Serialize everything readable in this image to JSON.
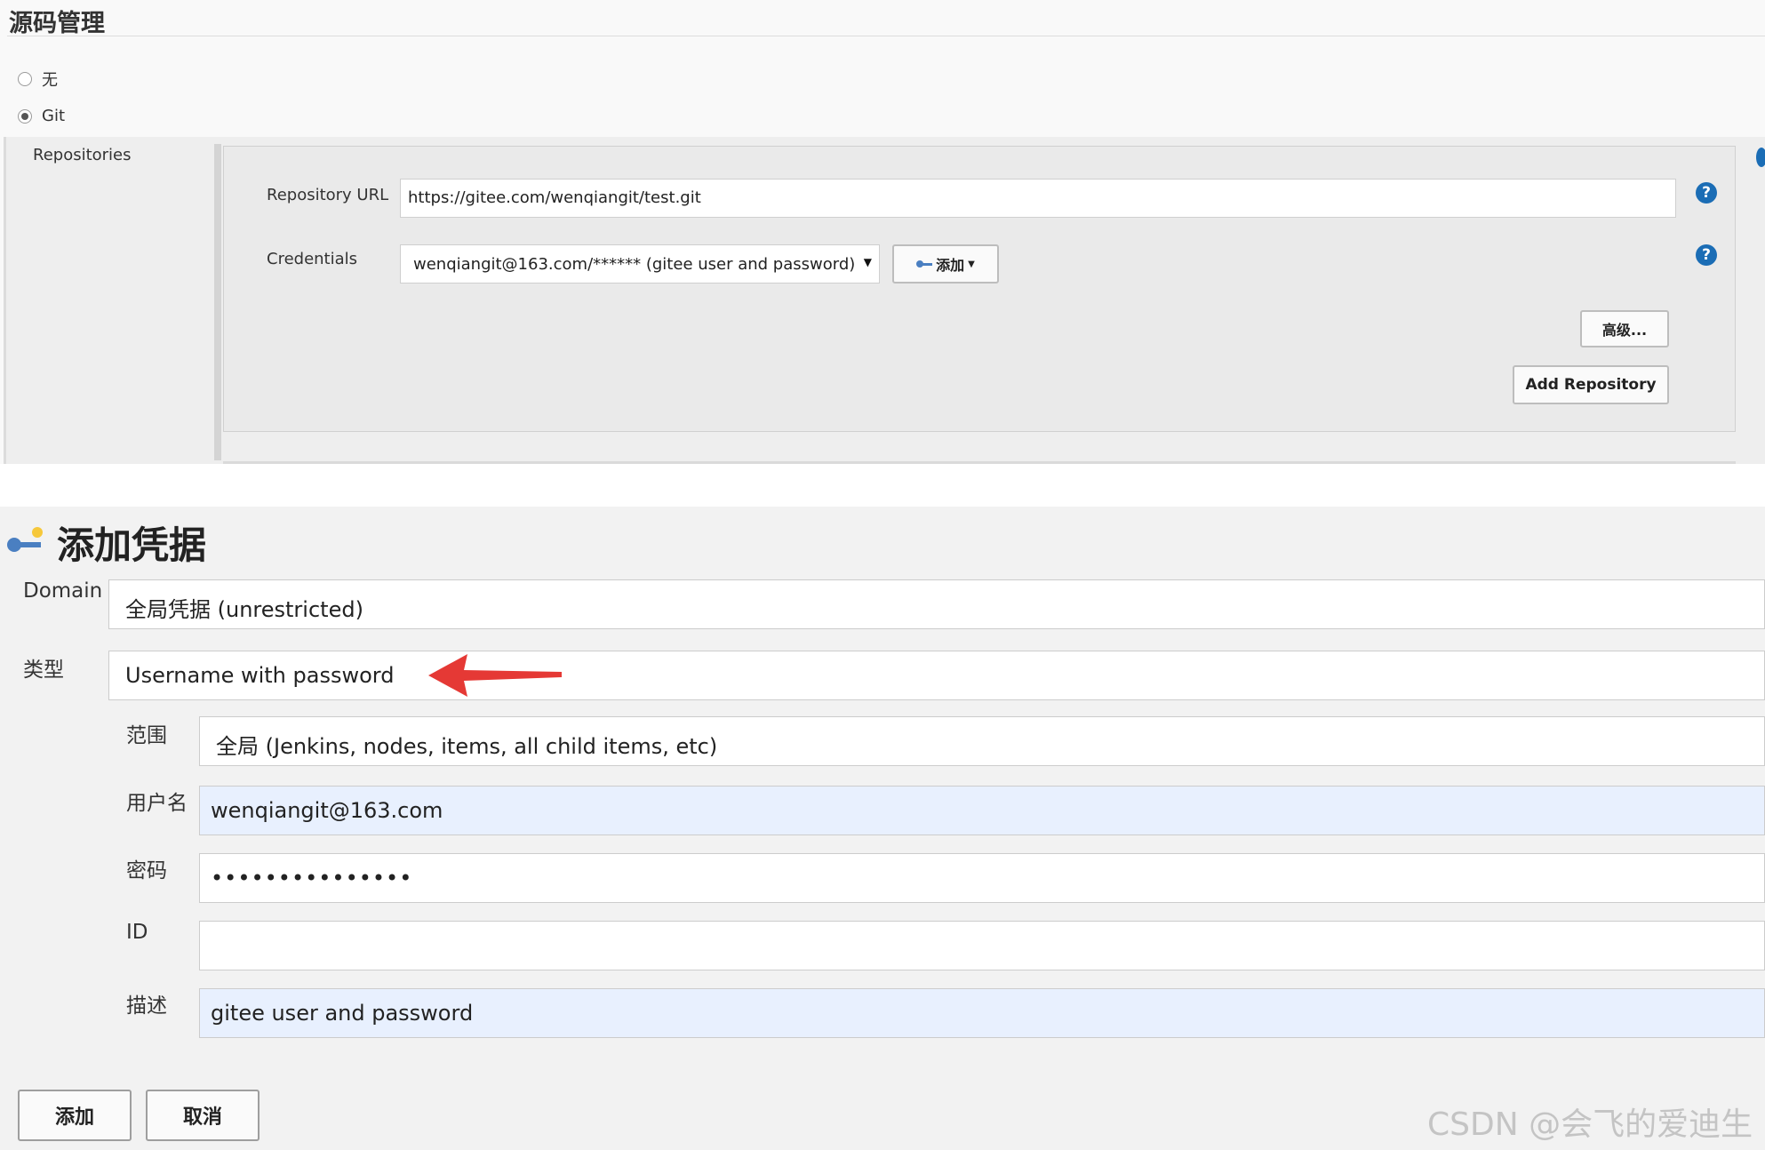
{
  "scm": {
    "title": "源码管理",
    "options": [
      {
        "label": "无",
        "checked": false
      },
      {
        "label": "Git",
        "checked": true
      }
    ],
    "repositories_label": "Repositories",
    "repository_url_label": "Repository URL",
    "repository_url_value": "https://gitee.com/wenqiangit/test.git",
    "credentials_label": "Credentials",
    "credentials_selected": "wenqiangit@163.com/****** (gitee user and password)",
    "credentials_add_label": "添加",
    "help_glyph": "?",
    "advanced_label": "高级...",
    "add_repository_label": "Add Repository"
  },
  "add_credentials": {
    "title": "添加凭据",
    "domain_label": "Domain",
    "domain_value": "全局凭据 (unrestricted)",
    "type_label": "类型",
    "type_value": "Username with password",
    "scope_label": "范围",
    "scope_value": "全局 (Jenkins, nodes, items, all child items, etc)",
    "username_label": "用户名",
    "username_value": "wenqiangit@163.com",
    "password_label": "密码",
    "password_value": "•••••••••••••••",
    "id_label": "ID",
    "id_value": "",
    "description_label": "描述",
    "description_value": "gitee user and password",
    "submit_label": "添加",
    "cancel_label": "取消"
  },
  "watermark": "CSDN @会飞的爱迪生",
  "colors": {
    "help": "#1b6db5",
    "autofill": "#e8f0fe",
    "arrow": "#e53935",
    "key": "#4a7fc1"
  }
}
